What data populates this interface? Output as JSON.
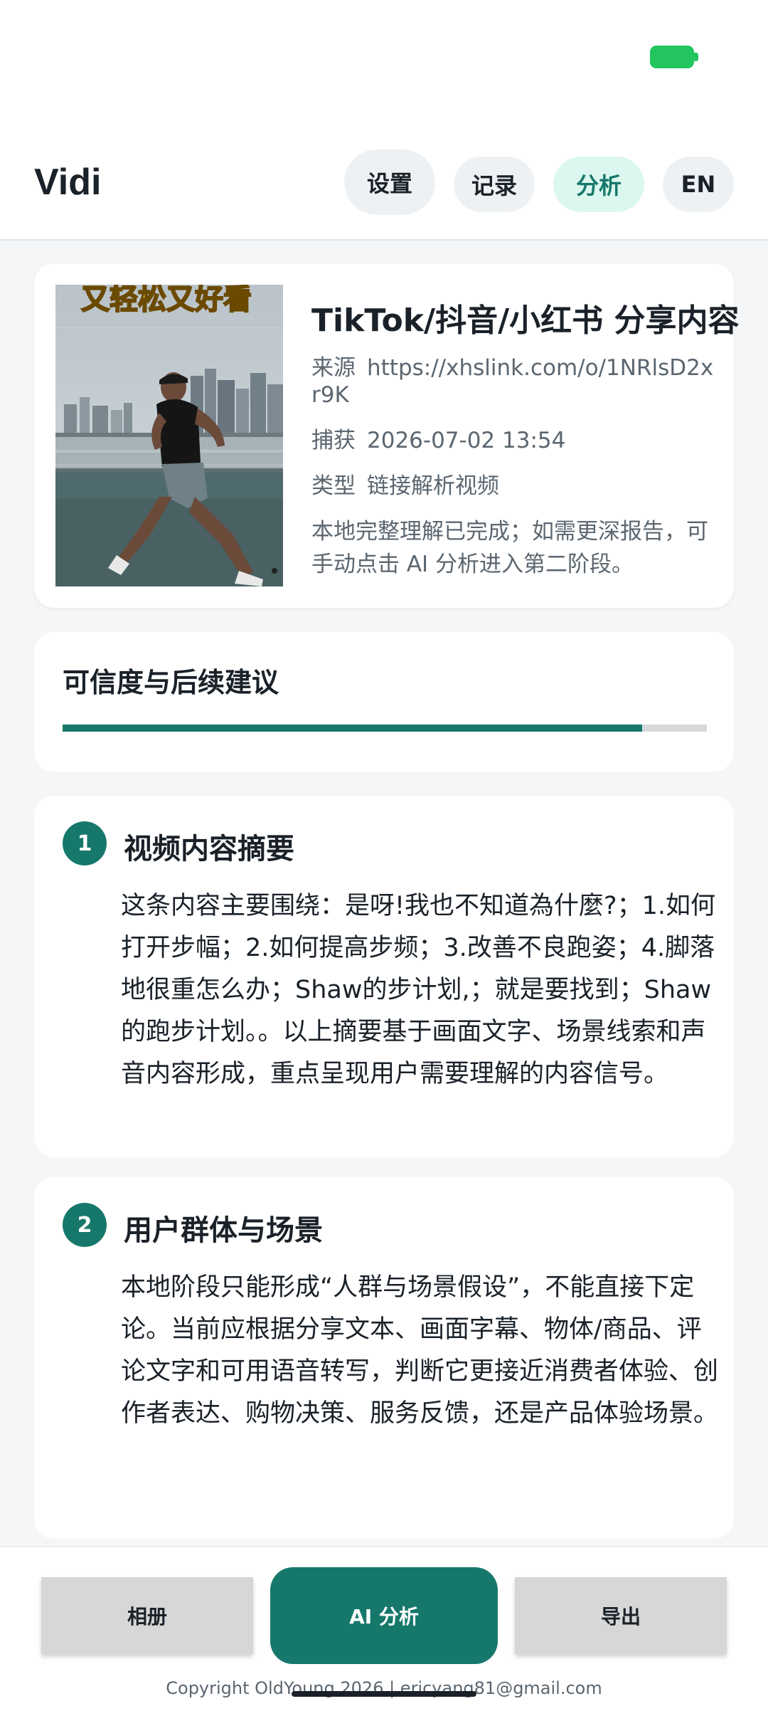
{
  "header": {
    "app_title": "Vidi",
    "nav": {
      "settings": "设置",
      "history": "记录",
      "analyze": "分析",
      "language": "EN"
    }
  },
  "media": {
    "thumbnail_caption": "又轻松又好看",
    "title": "TikTok/抖音/小红书 分享内容",
    "source_label": "来源",
    "source_value": "https://xhslink.com/o/1NRlsD2xr9K",
    "captured_label": "捕获",
    "captured_value": "2026-07-02 13:54",
    "type_label": "类型",
    "type_value": "链接解析视频",
    "note": "本地完整理解已完成；如需更深报告，可手动点击 AI 分析进入第二阶段。"
  },
  "confidence": {
    "title": "可信度与后续建议",
    "level_fraction": 0.9
  },
  "sections": [
    {
      "number": "1",
      "title": "视频内容摘要",
      "body": "这条内容主要围绕：是呀!我也不知道為什麼?；1.如何打开步幅；2.如何提高步频；3.改善不良跑姿；4.脚落地很重怎么办；Shaw的步计划,；就是要找到；Shaw的跑步计划。。以上摘要基于画面文字、场景线索和声音内容形成，重点呈现用户需要理解的内容信号。"
    },
    {
      "number": "2",
      "title": "用户群体与场景",
      "body": "本地阶段只能形成“人群与场景假设”，不能直接下定论。当前应根据分享文本、画面字幕、物体/商品、评论文字和可用语音转写，判断它更接近消费者体验、创作者表达、购物决策、服务反馈，还是产品体验场景。"
    }
  ],
  "bottom": {
    "album": "相册",
    "ai_analyze": "AI 分析",
    "export": "导出",
    "copyright": "Copyright OldYoung 2026 | ericyang81@gmail.com"
  },
  "colors": {
    "accent": "#16786b",
    "accent_light": "#dcf7ef",
    "battery": "#22c55e"
  }
}
